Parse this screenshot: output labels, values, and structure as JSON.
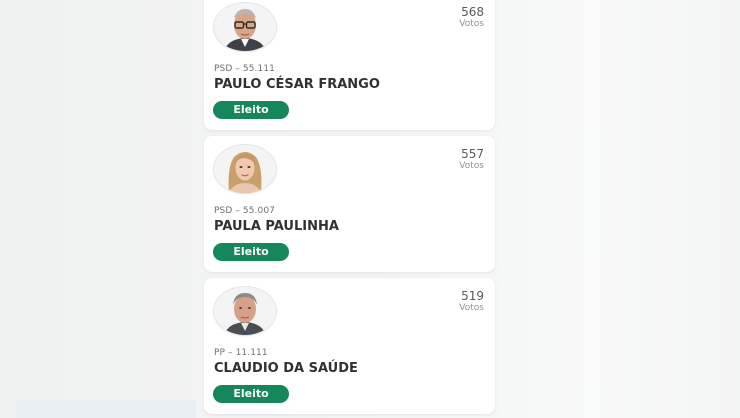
{
  "colors": {
    "elected_badge": "#16875b",
    "card_background": "#ffffff",
    "name_text": "#2f3235"
  },
  "candidates": [
    {
      "votes": "568",
      "votes_label": "Votos",
      "party": "PSD – 55.111",
      "name": "PAULO CÉSAR FRANGO",
      "status": "Eleito",
      "avatar_icon": "candidate-photo-male-glasses"
    },
    {
      "votes": "557",
      "votes_label": "Votos",
      "party": "PSD – 55.007",
      "name": "PAULA PAULINHA",
      "status": "Eleito",
      "avatar_icon": "candidate-photo-female"
    },
    {
      "votes": "519",
      "votes_label": "Votos",
      "party": "PP – 11.111",
      "name": "CLAUDIO DA SAÚDE",
      "status": "Eleito",
      "avatar_icon": "candidate-photo-male"
    }
  ]
}
